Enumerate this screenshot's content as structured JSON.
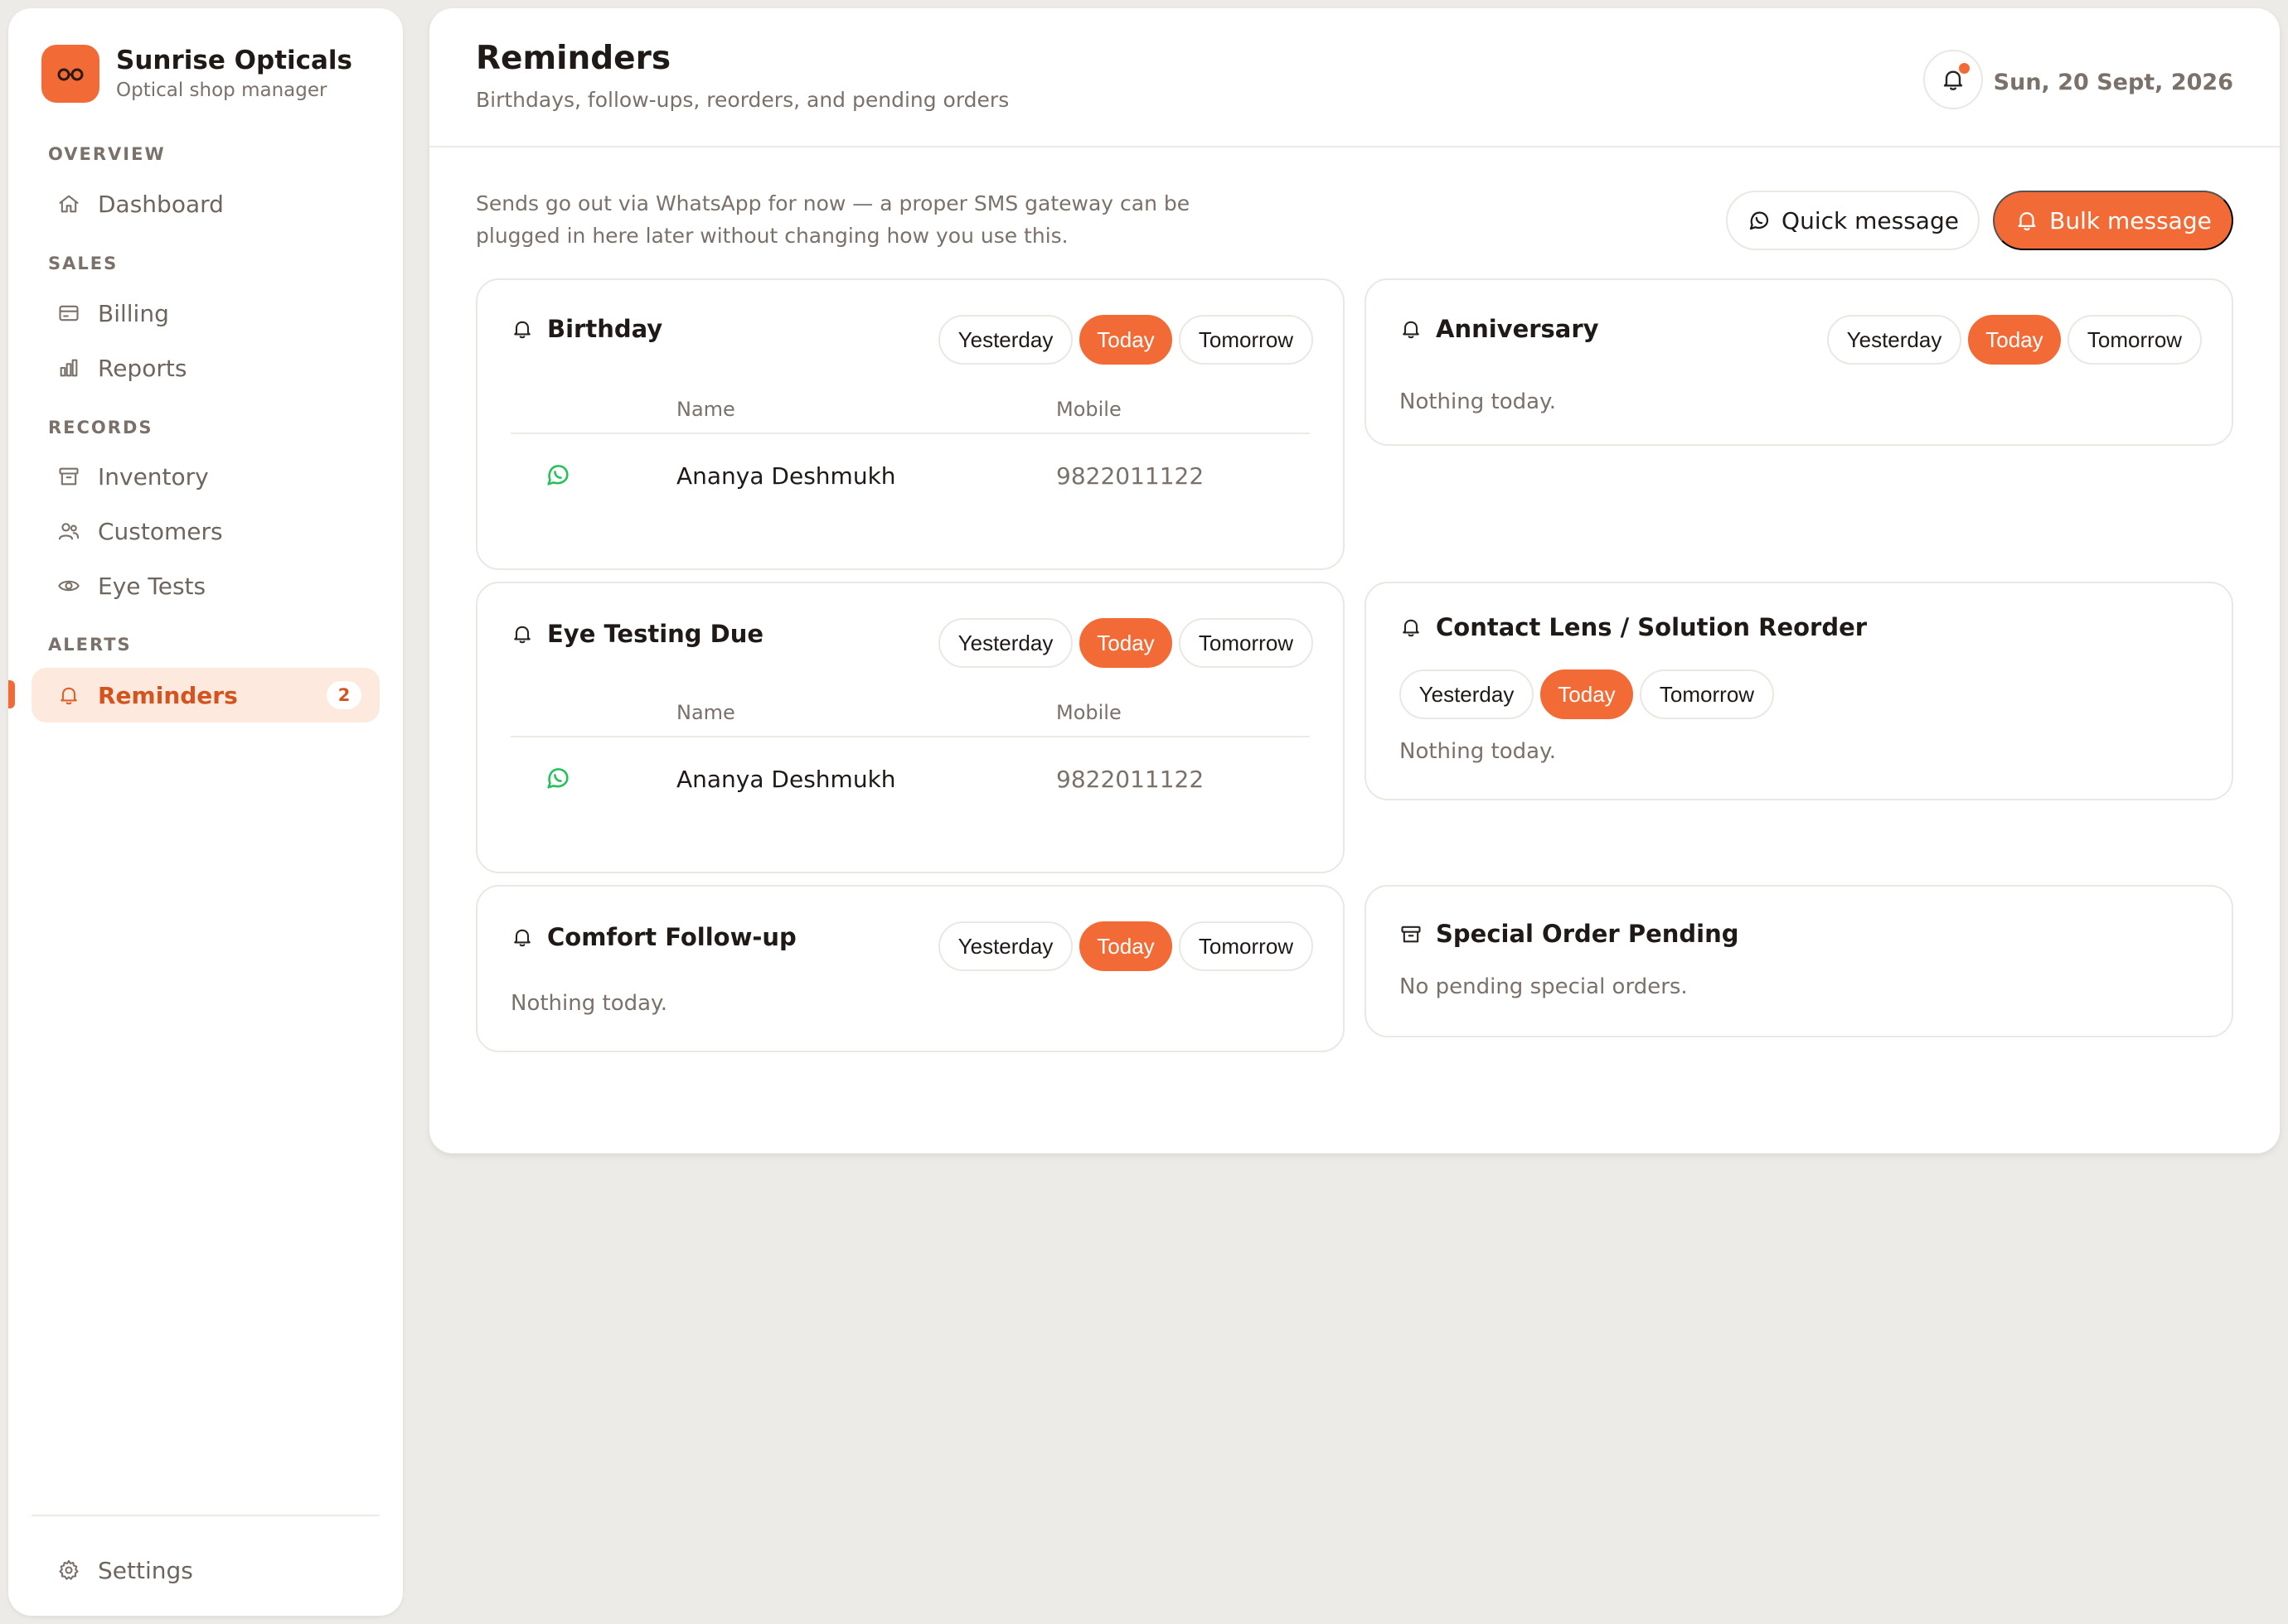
{
  "brand": {
    "name": "Sunrise Opticals",
    "subtitle": "Optical shop manager",
    "logo_icon": "glasses-icon",
    "color": "#f26a35"
  },
  "sidebar": {
    "sections": [
      {
        "label": "OVERVIEW"
      },
      {
        "label": "SALES"
      },
      {
        "label": "RECORDS"
      },
      {
        "label": "ALERTS"
      }
    ],
    "items": [
      {
        "label": "Dashboard",
        "icon": "home-icon"
      },
      {
        "label": "Billing",
        "icon": "card-icon"
      },
      {
        "label": "Reports",
        "icon": "bar-chart-icon"
      },
      {
        "label": "Inventory",
        "icon": "box-icon"
      },
      {
        "label": "Customers",
        "icon": "users-icon"
      },
      {
        "label": "Eye Tests",
        "icon": "eye-icon"
      },
      {
        "label": "Reminders",
        "icon": "bell-icon",
        "badge": "2",
        "active": true
      }
    ],
    "settings_label": "Settings"
  },
  "header": {
    "title": "Reminders",
    "subtitle": "Birthdays, follow-ups, reorders, and pending orders",
    "date": "Sun, 20 Sept, 2026"
  },
  "toolbar": {
    "note": "Sends go out via WhatsApp for now — a proper SMS gateway can be plugged in here later without changing how you use this.",
    "quick_label": "Quick message",
    "bulk_label": "Bulk message"
  },
  "filters": {
    "yesterday": "Yesterday",
    "today": "Today",
    "tomorrow": "Tomorrow",
    "selected": "Today"
  },
  "table_cols": {
    "name": "Name",
    "mobile": "Mobile"
  },
  "cards": {
    "birthday": {
      "title": "Birthday",
      "rows": [
        {
          "name": "Ananya Deshmukh",
          "mobile": "9822011122"
        }
      ]
    },
    "anniversary": {
      "title": "Anniversary",
      "empty": "Nothing today."
    },
    "eye_testing": {
      "title": "Eye Testing Due",
      "rows": [
        {
          "name": "Ananya Deshmukh",
          "mobile": "9822011122"
        }
      ]
    },
    "contact_lens": {
      "title": "Contact Lens / Solution Reorder",
      "empty": "Nothing today."
    },
    "comfort": {
      "title": "Comfort Follow-up",
      "empty": "Nothing today."
    },
    "special_order": {
      "title": "Special Order Pending",
      "empty": "No pending special orders."
    }
  },
  "colors": {
    "accent": "#f26a35",
    "whatsapp": "#25c05a",
    "muted": "#7a716a"
  }
}
